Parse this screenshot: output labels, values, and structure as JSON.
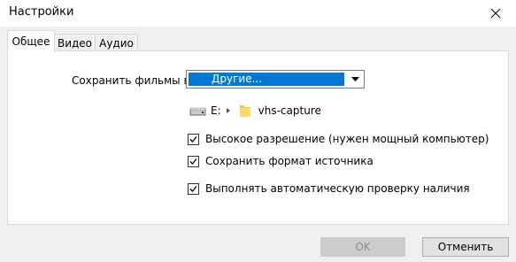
{
  "window": {
    "title": "Настройки"
  },
  "tabs": [
    {
      "label": "Общее",
      "active": true
    },
    {
      "label": "Видео",
      "active": false
    },
    {
      "label": "Аудио",
      "active": false
    }
  ],
  "general": {
    "save_label": "Сохранить фильмы в:",
    "save_location_selected": "Другие...",
    "path": {
      "drive": "E:",
      "folder": "vhs-capture"
    },
    "checkboxes": [
      {
        "label": "Высокое разрешение (нужен мощный компьютер)",
        "checked": true
      },
      {
        "label": "Сохранить формат источника",
        "checked": true
      },
      {
        "label": "Выполнять автоматическую проверку наличия",
        "checked": true
      }
    ]
  },
  "buttons": {
    "ok": "OK",
    "cancel": "Отменить"
  },
  "colors": {
    "selection": "#0078d7",
    "folder": "#f3c343"
  },
  "icons": [
    "close-icon",
    "dropdown-arrow-icon",
    "drive-icon",
    "breadcrumb-arrow-icon",
    "folder-icon",
    "checkmark-icon"
  ]
}
